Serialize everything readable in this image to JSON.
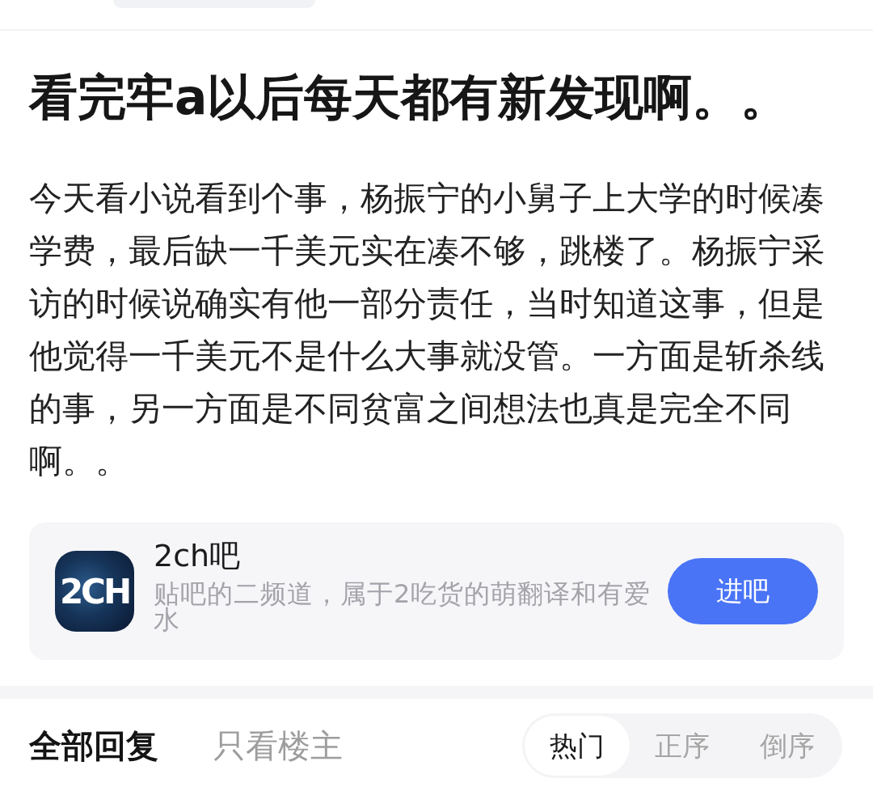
{
  "post": {
    "title": "看完牢a以后每天都有新发现啊。。",
    "body": "今天看小说看到个事，杨振宁的小舅子上大学的时候凑学费，最后缺一千美元实在凑不够，跳楼了。杨振宁采访的时候说确实有他一部分责任，当时知道这事，但是他觉得一千美元不是什么大事就没管。一方面是斩杀线的事，另一方面是不同贫富之间想法也真是完全不同啊。。"
  },
  "forum_card": {
    "logo_text": "2CH",
    "name": "2ch吧",
    "description": "贴吧的二频道，属于2吃货的萌翻译和有爱水",
    "button": "进吧"
  },
  "reply_tabs": [
    {
      "label": "全部回复",
      "selected": true
    },
    {
      "label": "只看楼主",
      "selected": false
    }
  ],
  "sort_options": [
    {
      "label": "热门",
      "selected": true
    },
    {
      "label": "正序",
      "selected": false
    },
    {
      "label": "倒序",
      "selected": false
    }
  ]
}
